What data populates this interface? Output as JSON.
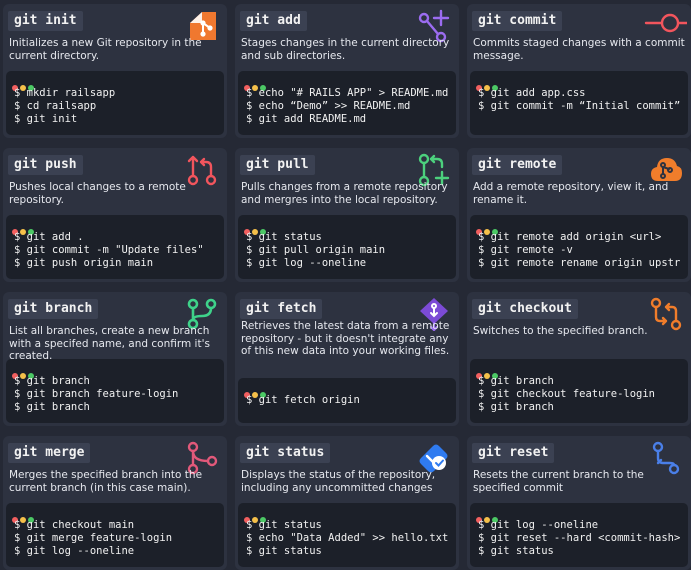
{
  "colors": {
    "page_bg": "#252935",
    "card_bg": "#2d3240",
    "terminal_bg": "#1c2029",
    "dot_red": "#f25f5f",
    "dot_yellow": "#f5c04a",
    "dot_green": "#4cc965"
  },
  "cards": [
    {
      "command": "git init",
      "description": "Initializes a new Git repository in the current directory.",
      "icon": "git-logo-icon",
      "lines": [
        "$ mkdir railsapp",
        "$ cd railsapp",
        "$ git init"
      ]
    },
    {
      "command": "git add",
      "description": "Stages changes in the current directory and sub directories.",
      "icon": "git-add-icon",
      "lines": [
        "$ echo \"# RAILS APP\" > README.md",
        "$ echo “Demo” >> README.md",
        "$ git add README.md"
      ]
    },
    {
      "command": "git commit",
      "description": "Commits staged changes with a commit message.",
      "icon": "commit-icon",
      "lines": [
        "$ git add app.css",
        "$ git commit -m “Initial commit”"
      ]
    },
    {
      "command": "git push",
      "description": "Pushes local changes to a remote repository.",
      "icon": "git-push-icon",
      "lines": [
        "$ git add .",
        "$ git commit -m \"Update files\"",
        "$ git push origin main"
      ]
    },
    {
      "command": "git pull",
      "description": "Pulls changes from a remote repository and mergres into the local repository.",
      "icon": "git-pull-icon",
      "lines": [
        "$ git status",
        "$ git pull origin main",
        "$ git log --oneline"
      ]
    },
    {
      "command": "git remote",
      "description": "Add a remote repository, view it, and rename it.",
      "icon": "cloud-remote-icon",
      "lines": [
        "$ git remote add origin <url>",
        "$ git remote -v",
        "$ git remote rename origin upstr"
      ]
    },
    {
      "command": "git branch",
      "description": "List all branches, create a new branch with a specifed name, and confirm it's created.",
      "icon": "git-branch-icon",
      "lines": [
        "$ git branch",
        "$ git branch feature-login",
        "$ git branch"
      ]
    },
    {
      "command": "git fetch",
      "description": "Retrieves the latest data from a remote repository - but it doesn't integrate any of this new data into your working files.",
      "icon": "fetch-icon",
      "lines": [
        "$ git fetch origin"
      ]
    },
    {
      "command": "git checkout",
      "description": "Switches to the specified branch.",
      "icon": "checkout-icon",
      "lines": [
        "$ git branch",
        "$ git checkout feature-login",
        "$ git branch"
      ]
    },
    {
      "command": "git merge",
      "description": "Merges the specified branch into the current branch (in this case main).",
      "icon": "git-merge-icon",
      "lines": [
        "$ git checkout main",
        "$ git merge feature-login",
        "$ git log --oneline"
      ]
    },
    {
      "command": "git status",
      "description": "Displays the status of the repository, including any uncommitted changes",
      "icon": "status-icon",
      "lines": [
        "$ git status",
        "$ echo \"Data Added\" >> hello.txt",
        "$ git status"
      ]
    },
    {
      "command": "git reset",
      "description": "Resets the current branch to the specified commit",
      "icon": "git-reset-icon",
      "lines": [
        "$ git log --oneline",
        "$ git reset --hard <commit-hash>",
        "$ git status"
      ]
    }
  ]
}
